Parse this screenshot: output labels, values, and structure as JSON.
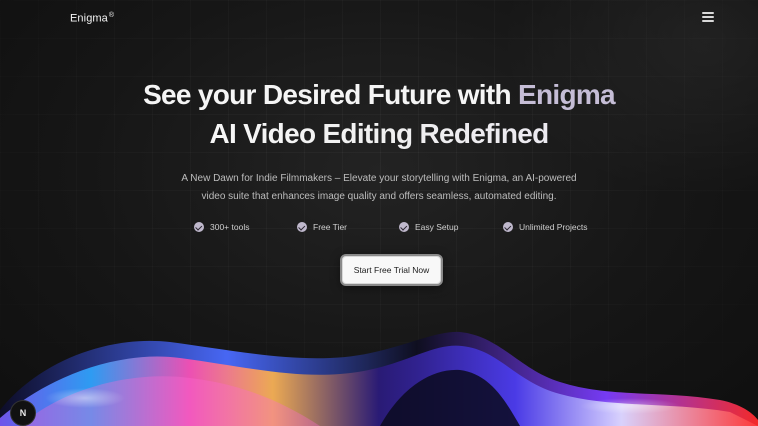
{
  "nav": {
    "brand": "Enigma",
    "brand_mark": "®",
    "menu_icon": "hamburger-menu-icon"
  },
  "hero": {
    "title_line1_white": "See your Desired Future with",
    "title_line1_accent": "Enigma",
    "title_line2": "AI Video Editing Redefined",
    "subtitle_line1": "A New Dawn for Indie Filmmakers – Elevate your storytelling with Enigma, an AI-powered",
    "subtitle_line2": "video suite that enhances image quality and offers seamless, automated editing."
  },
  "features": [
    {
      "label": "300+ tools",
      "icon": "check-circle-icon"
    },
    {
      "label": "Free Tier",
      "icon": "check-circle-icon"
    },
    {
      "label": "Easy Setup",
      "icon": "check-circle-icon"
    },
    {
      "label": "Unlimited Projects",
      "icon": "check-circle-icon"
    }
  ],
  "cta": {
    "label": "Start Free Trial Now"
  },
  "badge": {
    "label": "N"
  },
  "colors": {
    "background": "#121212",
    "accent_text": "#c5bdd6",
    "check": "#bfb8cc",
    "cta_bg": "#f8f8f8"
  }
}
